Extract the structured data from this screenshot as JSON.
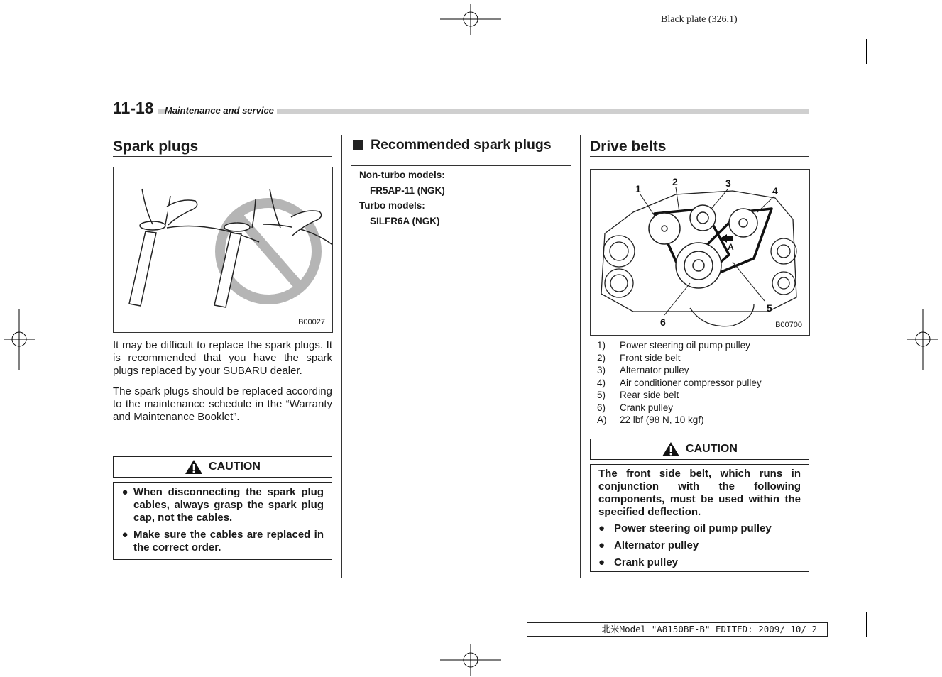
{
  "plate_label": "Black plate (326,1)",
  "header": {
    "page_number": "11-18",
    "section": "Maintenance and service"
  },
  "spark_plugs": {
    "title": "Spark plugs",
    "figure_code": "B00027",
    "paragraphs": [
      "It may be difficult to replace the spark plugs. It is recommended that you have the spark plugs replaced by your SUBARU dealer.",
      "The spark plugs should be replaced according to the maintenance schedule in the “Warranty and Maintenance Booklet”."
    ],
    "caution": {
      "label": "CAUTION",
      "items": [
        "When disconnecting the spark plug cables, always grasp the spark plug cap, not the cables.",
        "Make sure the cables are replaced in the correct order."
      ]
    }
  },
  "recommended": {
    "title": "Recommended spark plugs",
    "rows": [
      {
        "label": "Non-turbo models:",
        "value": "FR5AP-11 (NGK)"
      },
      {
        "label": "Turbo models:",
        "value": "SILFR6A (NGK)"
      }
    ]
  },
  "drive_belts": {
    "title": "Drive belts",
    "figure_code": "B00700",
    "callouts": [
      "1",
      "2",
      "3",
      "4",
      "5",
      "6",
      "A"
    ],
    "legend": [
      {
        "key": "1)",
        "text": "Power steering oil pump pulley"
      },
      {
        "key": "2)",
        "text": "Front side belt"
      },
      {
        "key": "3)",
        "text": "Alternator pulley"
      },
      {
        "key": "4)",
        "text": "Air conditioner compressor pulley"
      },
      {
        "key": "5)",
        "text": "Rear side belt"
      },
      {
        "key": "6)",
        "text": "Crank pulley"
      },
      {
        "key": "A)",
        "text": "22 lbf (98 N, 10 kgf)"
      }
    ],
    "caution": {
      "label": "CAUTION",
      "intro": "The front side belt, which runs in conjunction with the following components, must be used within the specified deflection.",
      "items": [
        "Power steering oil pump pulley",
        "Alternator pulley",
        "Crank pulley"
      ]
    }
  },
  "footer": "北米Model \"A8150BE-B\" EDITED: 2009/ 10/ 2"
}
